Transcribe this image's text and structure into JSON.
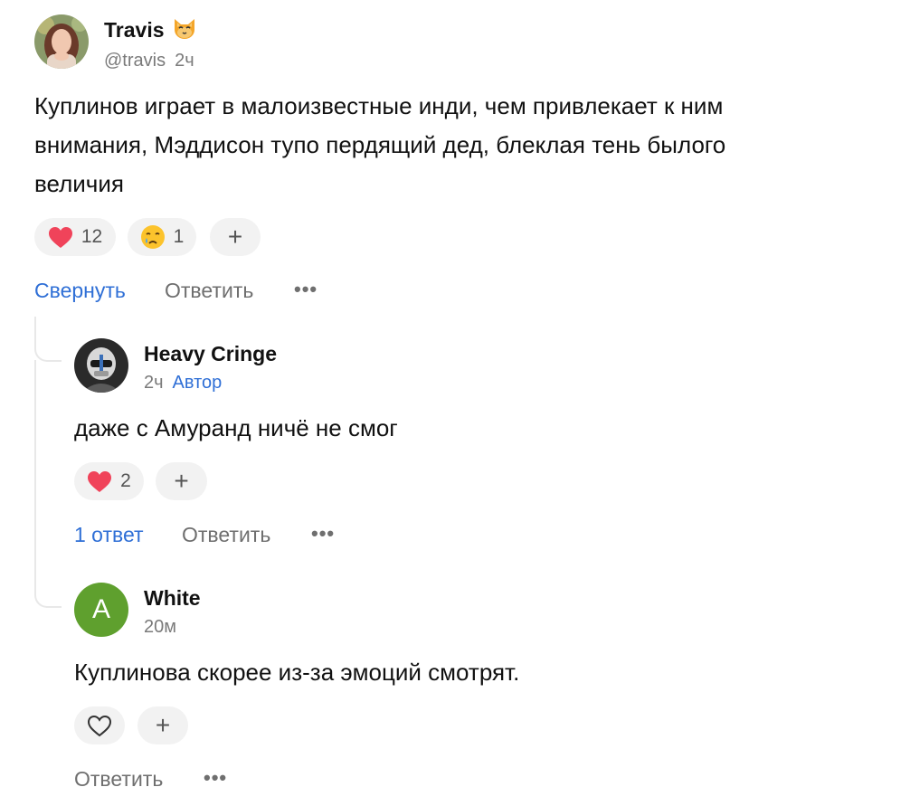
{
  "comments": [
    {
      "username": "Travis",
      "username_emoji": "cat-face-icon",
      "handle": "@travis",
      "time": "2ч",
      "text": "Куплинов играет в малоизвестные инди, чем привлекает к ним внимания, Мэддисон тупо пердящий дед, блеклая тень былого величия",
      "reactions": [
        {
          "icon": "heart-icon",
          "count": "12"
        },
        {
          "icon": "crying-face-icon",
          "count": "1"
        }
      ],
      "add_reaction": "+",
      "collapse_label": "Свернуть",
      "reply_label": "Ответить",
      "more": "•••"
    },
    {
      "username": "Heavy Cringe",
      "time": "2ч",
      "author_badge": "Автор",
      "text": "даже с Амуранд ничё не смог",
      "reactions": [
        {
          "icon": "heart-icon",
          "count": "2"
        }
      ],
      "add_reaction": "+",
      "replies_label": "1 ответ",
      "reply_label": "Ответить",
      "more": "•••"
    },
    {
      "username": "White",
      "avatar_letter": "A",
      "time": "20м",
      "text": "Куплинова скорее из-за эмоций смотрят.",
      "like_icon": "heart-outline-icon",
      "add_reaction": "+",
      "reply_label": "Ответить",
      "more": "•••"
    }
  ],
  "colors": {
    "link": "#2f6fd6",
    "heart": "#f0435a",
    "pill_bg": "#f2f2f2",
    "avatar_white_bg": "#5fa02e"
  }
}
